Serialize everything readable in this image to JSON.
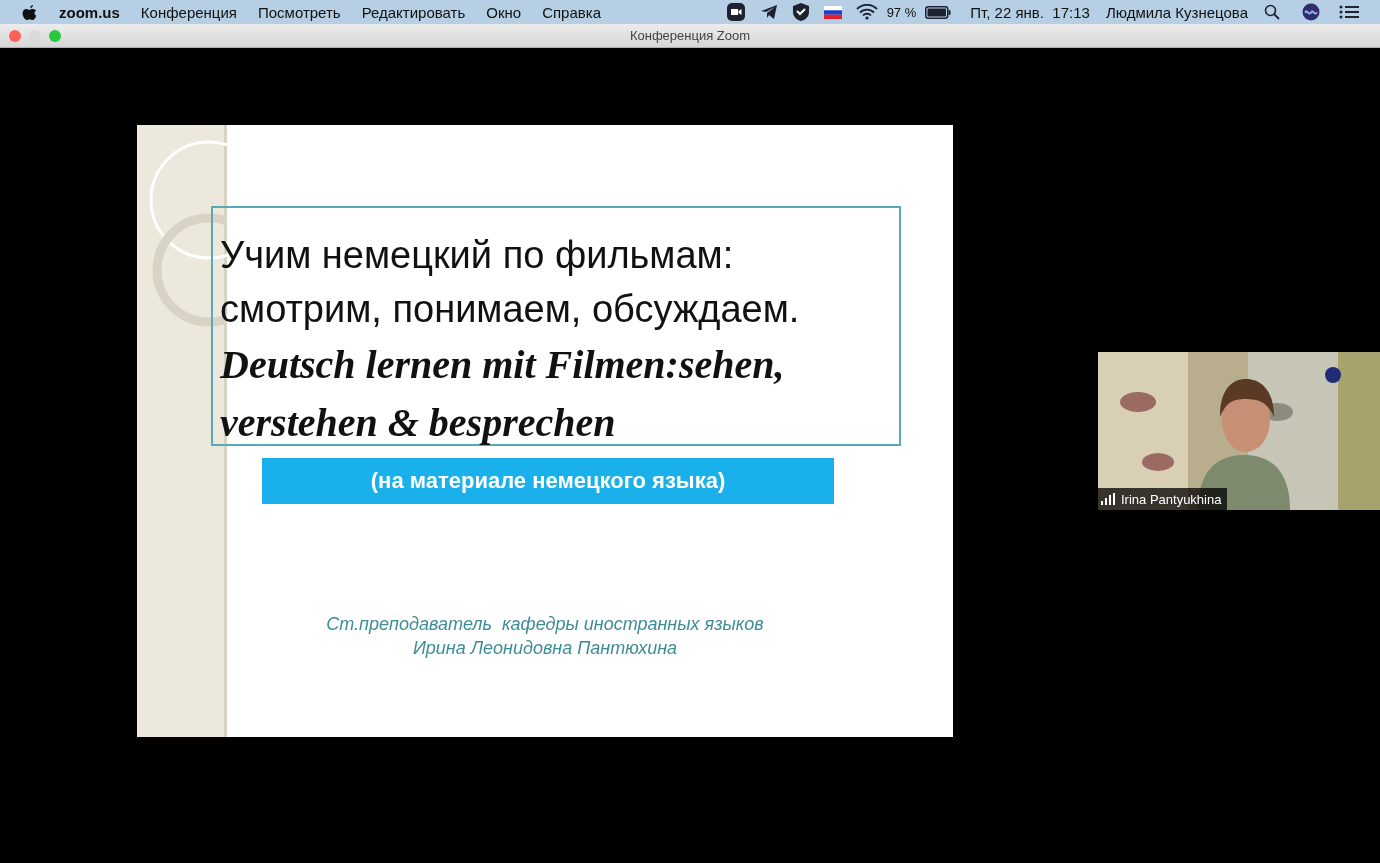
{
  "menubar": {
    "app_name": "zoom.us",
    "menus": [
      "Конференция",
      "Посмотреть",
      "Редактировать",
      "Окно",
      "Справка"
    ],
    "battery": "97 %",
    "datetime": "Пт, 22 янв.  17:13",
    "user": "Людмила Кузнецова"
  },
  "window": {
    "title": "Конференция Zoom"
  },
  "slide": {
    "title_lines": [
      "Учим немецкий по фильмам:",
      "смотрим, понимаем, обсуждаем."
    ],
    "german_lines": [
      "Deutsch lernen mit Filmen:sehen,",
      "verstehen & besprechen"
    ],
    "subtitle": "(на материале немецкого языка)",
    "author_lines": [
      "Ст.преподаватель  кафедры иностранных языков",
      "Ирина Леонидовна Пантюхина"
    ]
  },
  "video": {
    "kind": "picture",
    "participant": "Irina Pantyukhina"
  }
}
